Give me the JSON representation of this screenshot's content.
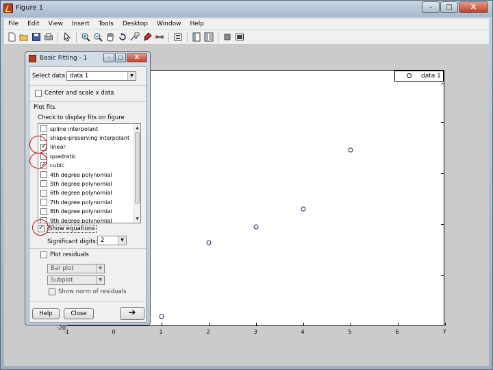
{
  "figure_window": {
    "title": "Figure 1",
    "minimize": "–",
    "maximize": "□",
    "close": "X"
  },
  "menu": [
    "File",
    "Edit",
    "View",
    "Insert",
    "Tools",
    "Desktop",
    "Window",
    "Help"
  ],
  "toolbar_icons": [
    "new-file-icon",
    "open-folder-icon",
    "save-icon",
    "print-icon",
    "pointer-icon",
    "zoom-in-icon",
    "zoom-out-icon",
    "pan-hand-icon",
    "rotate-icon",
    "data-cursor-icon",
    "brush-icon",
    "link-icon",
    "insert-colorbar-icon",
    "insert-legend-icon",
    "hide-plot-tools-icon",
    "show-plot-tools-icon"
  ],
  "plot": {
    "legend_label": "data 1",
    "x_ticks": [
      "-1",
      "0",
      "1",
      "2",
      "3",
      "4",
      "5",
      "6",
      "7"
    ],
    "y_min_label": "-20",
    "xlim": [
      -1,
      7
    ],
    "points": [
      {
        "x": 1,
        "y": 0.04
      },
      {
        "x": 2,
        "y": 0.33
      },
      {
        "x": 3,
        "y": 0.39
      },
      {
        "x": 4,
        "y": 0.46
      },
      {
        "x": 5,
        "y": 0.69
      }
    ]
  },
  "dialog": {
    "title": "Basic Fitting - 1",
    "select_data_label": "Select data:",
    "select_data_value": "data 1",
    "center_scale_label": "Center and scale x data",
    "plot_fits_label": "Plot fits",
    "check_display_label": "Check to display fits on figure",
    "fits": [
      {
        "label": "spline interpolant",
        "checked": false
      },
      {
        "label": "shape-preserving interpolant",
        "checked": false
      },
      {
        "label": "linear",
        "checked": true
      },
      {
        "label": "quadratic",
        "checked": false
      },
      {
        "label": "cubic",
        "checked": true
      },
      {
        "label": "4th degree polynomial",
        "checked": false
      },
      {
        "label": "5th degree polynomial",
        "checked": false
      },
      {
        "label": "6th degree polynomial",
        "checked": false
      },
      {
        "label": "7th degree polynomial",
        "checked": false
      },
      {
        "label": "8th degree polynomial",
        "checked": false
      },
      {
        "label": "9th degree polynomial",
        "checked": false
      }
    ],
    "show_equations_label": "Show equations",
    "significant_digits_label": "Significant digits:",
    "significant_digits_value": "2",
    "plot_residuals_label": "Plot residuals",
    "residual_plot_type": "Bar plot",
    "residual_location": "Subplot",
    "show_norm_label": "Show norm of residuals",
    "help_button": "Help",
    "close_button": "Close",
    "next_button": "➔",
    "minimize": "–",
    "maximize": "□",
    "close": "X"
  }
}
